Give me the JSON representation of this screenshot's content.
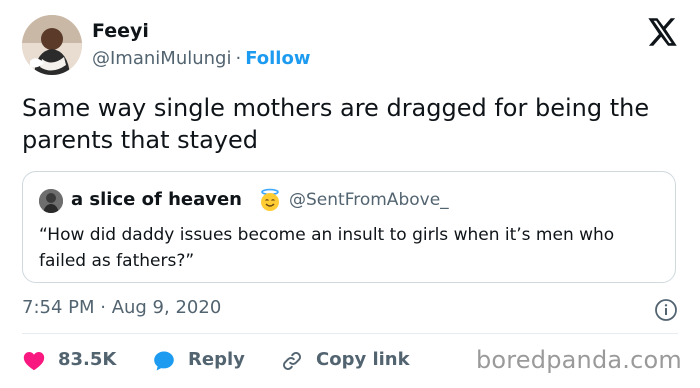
{
  "author": {
    "name": "Feeyi",
    "handle": "@ImaniMulungi",
    "separator": "·",
    "follow_label": "Follow"
  },
  "tweet": {
    "text": "Same way single mothers are dragged for being the parents that stayed"
  },
  "quote": {
    "name": "a slice of heaven",
    "emoji_icon": "smiling-face-with-halo",
    "handle": "@SentFromAbove_",
    "text": "“How did daddy issues become an insult to girls when it’s men who failed as fathers?”"
  },
  "meta": {
    "timestamp": "7:54 PM · Aug 9, 2020"
  },
  "actions": {
    "like_count": "83.5K",
    "reply_label": "Reply",
    "copy_link_label": "Copy link"
  },
  "watermark": "boredpanda.com",
  "colors": {
    "accent": "#1d9bf0",
    "like": "#f91880",
    "text": "#0f1419",
    "muted": "#536471",
    "border": "#cfd9de"
  }
}
